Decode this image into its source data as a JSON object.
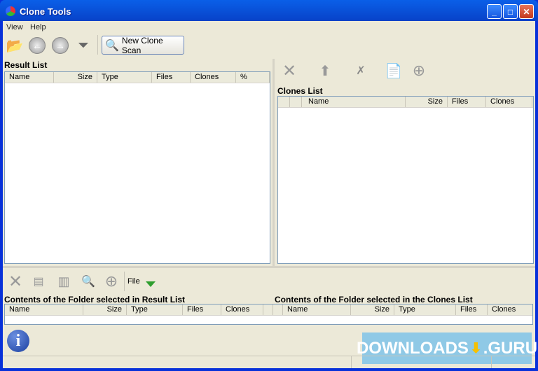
{
  "window": {
    "title": "Clone Tools",
    "minimize": "_",
    "maximize": "□",
    "close": "✕"
  },
  "menu": [
    "View",
    "Help"
  ],
  "toolbar": {
    "new_scan_label": "New Clone Scan"
  },
  "result_list": {
    "title": "Result List",
    "columns": [
      "Name",
      "Size",
      "Type",
      "Files",
      "Clones",
      "%"
    ]
  },
  "clones_list": {
    "title": "Clones List",
    "columns": [
      "",
      "",
      "Name",
      "Size",
      "Files",
      "Clones"
    ]
  },
  "bottom_toolbar": {
    "file_label": "File"
  },
  "folder_result": {
    "title": "Contents of the Folder selected in Result List",
    "columns": [
      "Name",
      "Size",
      "Type",
      "Files",
      "Clones"
    ]
  },
  "folder_clones": {
    "title": "Contents of the Folder selected in the Clones List",
    "columns": [
      "Name",
      "Size",
      "Type",
      "Files",
      "Clones"
    ]
  },
  "watermark": "DOWNLOADS .GURU"
}
